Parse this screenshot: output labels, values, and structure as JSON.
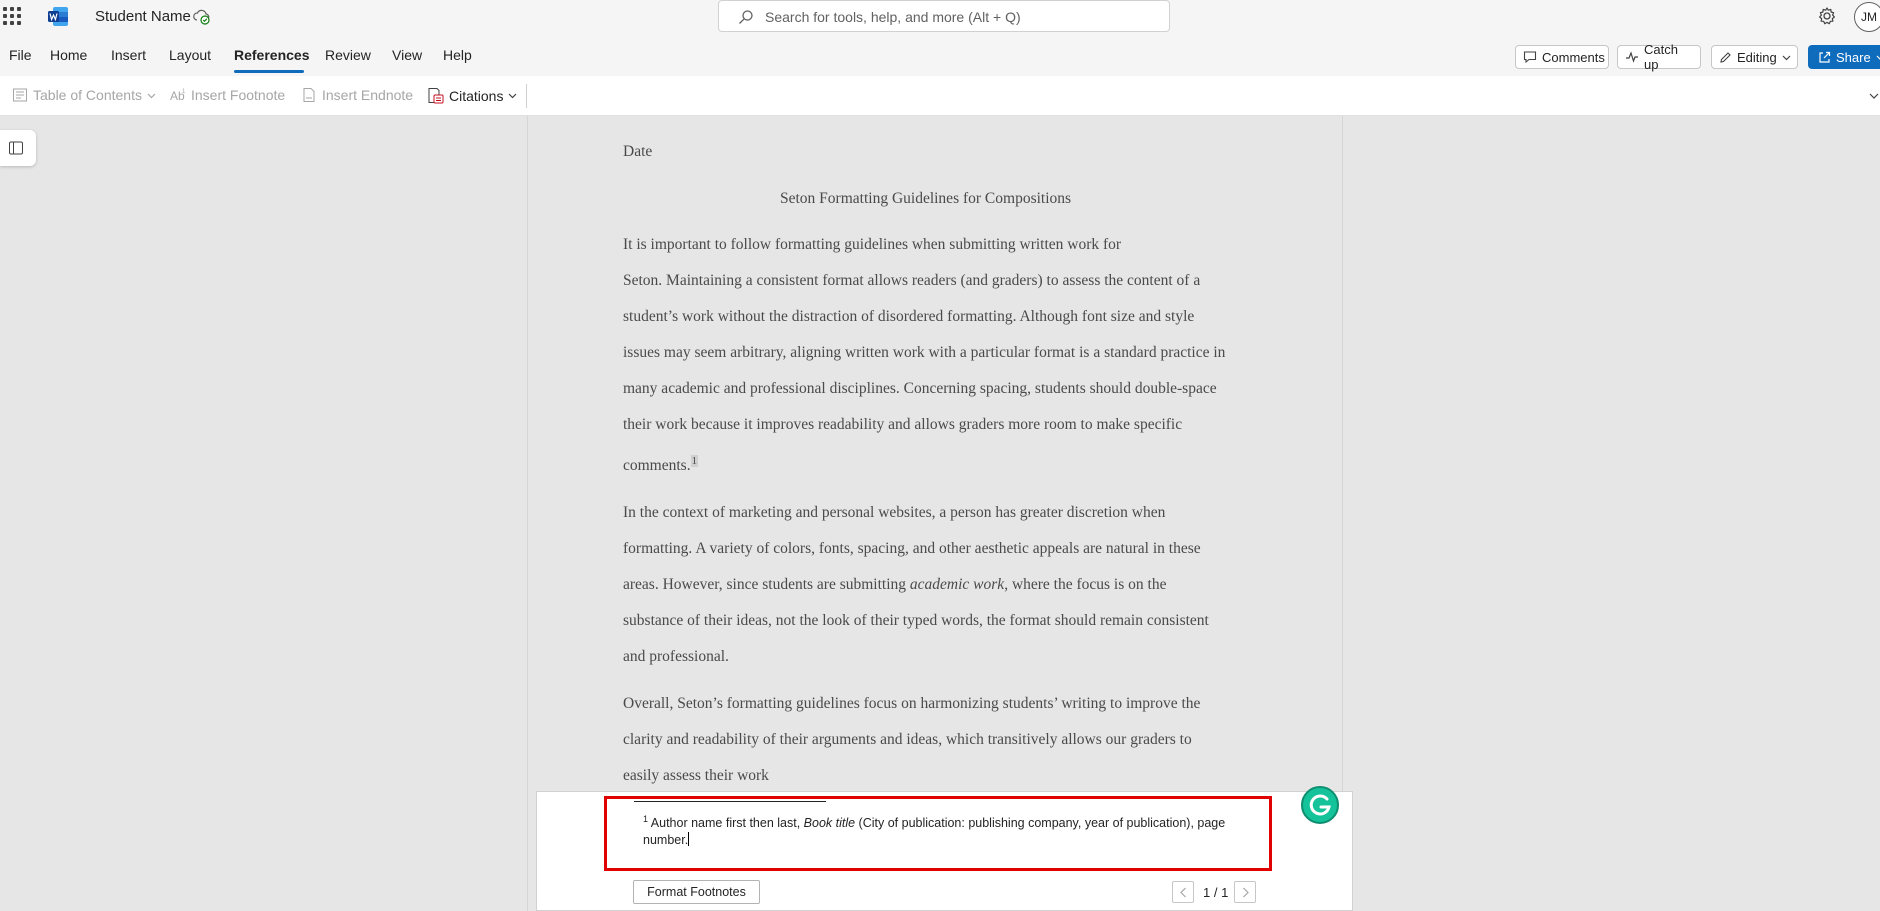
{
  "titlebar": {
    "doc_name": "Student Name",
    "search_placeholder": "Search for tools, help, and more (Alt + Q)",
    "avatar_initials": "JM"
  },
  "menubar": {
    "items": [
      "File",
      "Home",
      "Insert",
      "Layout",
      "References",
      "Review",
      "View",
      "Help"
    ],
    "active": "References",
    "comments_label": "Comments",
    "catchup_label": "Catch up",
    "editing_label": "Editing",
    "share_label": "Share"
  },
  "ribbon": {
    "toc_label": "Table of Contents",
    "insert_footnote_label": "Insert Footnote",
    "insert_endnote_label": "Insert Endnote",
    "citations_label": "Citations"
  },
  "document": {
    "date": "Date",
    "title": "Seton Formatting Guidelines for Compositions",
    "p1_lines": [
      "It is important to follow formatting guidelines when submitting written work for",
      "Seton. Maintaining a consistent format allows readers (and graders) to assess the content of a",
      "student’s work without the distraction of disordered formatting. Although font size and style",
      "issues may seem arbitrary, aligning written work with a particular format is a standard practice in",
      "many academic and professional disciplines. Concerning spacing, students should double-space",
      "their work because it improves readability and allows graders more room to make specific",
      "comments."
    ],
    "p1_footnote_ref": "1",
    "p2_lines": [
      "In the context of marketing and personal websites, a person has greater discretion when",
      "formatting. A variety of colors, fonts, spacing, and other aesthetic appeals are natural in these"
    ],
    "p2_line3_before": "areas. However, since students are submitting ",
    "p2_line3_italic": "academic work",
    "p2_line3_after": ", where the focus is on the",
    "p2_lines_end": [
      "substance of their ideas, not the look of their typed words, the format should remain consistent",
      "and professional."
    ],
    "p3_lines": [
      "Overall, Seton’s formatting guidelines focus on harmonizing students’ writing to improve the",
      "clarity and readability of their arguments and ideas, which transitively allows our graders to",
      "easily assess their work"
    ]
  },
  "footnote_pane": {
    "number": "1",
    "text_before": " Author name first then last, ",
    "text_italic": "Book title",
    "text_after": " (City of publication: publishing company, year of publication), page number.",
    "format_button_label": "Format Footnotes",
    "page_indicator": "1 / 1"
  },
  "colors": {
    "accent": "#0f6cbd",
    "highlight_border": "#e00000",
    "grammarly": "#15c39a"
  }
}
